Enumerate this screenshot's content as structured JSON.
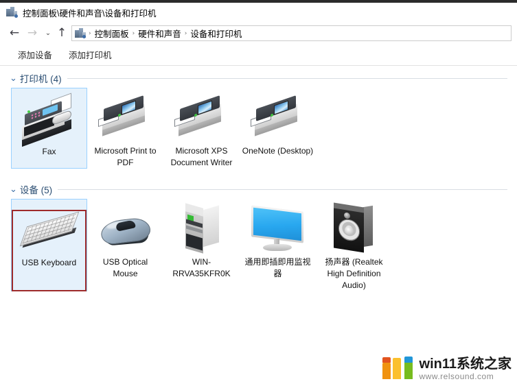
{
  "window": {
    "title": "控制面板\\硬件和声音\\设备和打印机",
    "title_icon": "control-panel-icon"
  },
  "navbar": {
    "back_icon": "←",
    "forward_icon": "→",
    "history_icon": "⌄",
    "up_icon": "↑",
    "breadcrumb_icon": "control-panel-icon",
    "separator": "›",
    "crumbs": [
      {
        "label": "控制面板"
      },
      {
        "label": "硬件和声音"
      },
      {
        "label": "设备和打印机"
      }
    ]
  },
  "toolbar": {
    "items": [
      {
        "label": "添加设备",
        "name": "add-device-button"
      },
      {
        "label": "添加打印机",
        "name": "add-printer-button"
      }
    ]
  },
  "groups": [
    {
      "name": "printers",
      "chevron": "⌄",
      "title": "打印机 (4)",
      "items": [
        {
          "label": "Fax",
          "icon": "fax-machine-icon",
          "selected": true,
          "annotated": false
        },
        {
          "label": "Microsoft Print to PDF",
          "icon": "printer-icon",
          "selected": false,
          "annotated": false
        },
        {
          "label": "Microsoft XPS Document Writer",
          "icon": "printer-icon",
          "selected": false,
          "annotated": false
        },
        {
          "label": "OneNote (Desktop)",
          "icon": "printer-icon",
          "selected": false,
          "annotated": false
        }
      ]
    },
    {
      "name": "devices",
      "chevron": "⌄",
      "title": "设备 (5)",
      "items": [
        {
          "label": "USB Keyboard",
          "icon": "keyboard-icon",
          "selected": true,
          "annotated": true
        },
        {
          "label": "USB Optical Mouse",
          "icon": "mouse-icon",
          "selected": false,
          "annotated": false
        },
        {
          "label": "WIN-RRVA35KFR0K",
          "icon": "pc-tower-icon",
          "selected": false,
          "annotated": false
        },
        {
          "label": "通用即插即用监视器",
          "icon": "monitor-icon",
          "selected": false,
          "annotated": false
        },
        {
          "label": "扬声器 (Realtek High Definition Audio)",
          "icon": "speaker-icon",
          "selected": false,
          "annotated": false
        }
      ]
    }
  ],
  "watermark": {
    "title": "win11系统之家",
    "url": "www.relsound.com"
  },
  "colors": {
    "selection_fill": "#e5f1fb",
    "selection_border": "#99d1ff",
    "annotation_border": "#9e2a2a",
    "group_title": "#2a4d72"
  }
}
